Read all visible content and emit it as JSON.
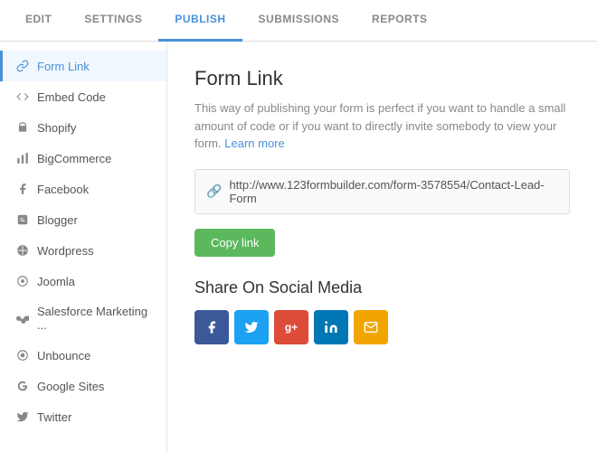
{
  "topNav": {
    "items": [
      {
        "id": "edit",
        "label": "EDIT",
        "active": false
      },
      {
        "id": "settings",
        "label": "SETTINGS",
        "active": false
      },
      {
        "id": "publish",
        "label": "PUBLISH",
        "active": true
      },
      {
        "id": "submissions",
        "label": "SUBMISSIONS",
        "active": false
      },
      {
        "id": "reports",
        "label": "REPORTS",
        "active": false
      }
    ]
  },
  "sidebar": {
    "items": [
      {
        "id": "form-link",
        "label": "Form Link",
        "icon": "🔗",
        "iconType": "link",
        "active": true
      },
      {
        "id": "embed-code",
        "label": "Embed Code",
        "icon": "<>",
        "iconType": "code",
        "active": false
      },
      {
        "id": "shopify",
        "label": "Shopify",
        "icon": "🛍",
        "iconType": "shopify",
        "active": false
      },
      {
        "id": "bigcommerce",
        "label": "BigCommerce",
        "icon": "📊",
        "iconType": "bigcommerce",
        "active": false
      },
      {
        "id": "facebook",
        "label": "Facebook",
        "icon": "f",
        "iconType": "facebook",
        "active": false
      },
      {
        "id": "blogger",
        "label": "Blogger",
        "icon": "B",
        "iconType": "blogger",
        "active": false
      },
      {
        "id": "wordpress",
        "label": "Wordpress",
        "icon": "W",
        "iconType": "wordpress",
        "active": false
      },
      {
        "id": "joomla",
        "label": "Joomla",
        "icon": "J",
        "iconType": "joomla",
        "active": false
      },
      {
        "id": "salesforce",
        "label": "Salesforce Marketing ...",
        "icon": "X",
        "iconType": "salesforce",
        "active": false
      },
      {
        "id": "unbounce",
        "label": "Unbounce",
        "icon": "U",
        "iconType": "unbounce",
        "active": false
      },
      {
        "id": "google-sites",
        "label": "Google Sites",
        "icon": "G",
        "iconType": "google",
        "active": false
      },
      {
        "id": "twitter",
        "label": "Twitter",
        "icon": "t",
        "iconType": "twitter",
        "active": false
      }
    ]
  },
  "content": {
    "title": "Form Link",
    "description": "This way of publishing your form is perfect if you want to handle a small amount of code or if you want to directly invite somebody to view your form.",
    "learnMore": "Learn more",
    "formUrl": "http://www.123formbuilder.com/form-3578554/Contact-Lead-Form",
    "copyButtonLabel": "Copy link",
    "shareTitle": "Share On Social Media",
    "socialButtons": [
      {
        "id": "facebook",
        "label": "f",
        "class": "facebook",
        "title": "Share on Facebook"
      },
      {
        "id": "twitter",
        "label": "t",
        "class": "twitter",
        "title": "Share on Twitter"
      },
      {
        "id": "googleplus",
        "label": "g+",
        "class": "googleplus",
        "title": "Share on Google+"
      },
      {
        "id": "linkedin",
        "label": "in",
        "class": "linkedin",
        "title": "Share on LinkedIn"
      },
      {
        "id": "email",
        "label": "✉",
        "class": "email",
        "title": "Share via Email"
      }
    ]
  }
}
